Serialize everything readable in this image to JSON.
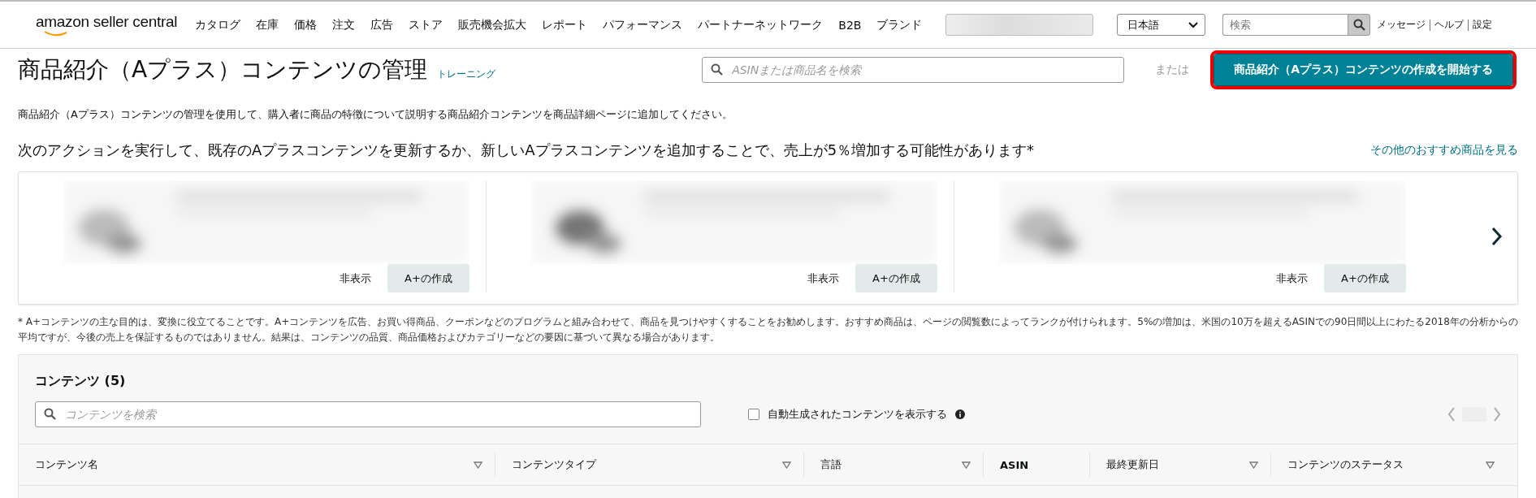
{
  "header": {
    "logo": "amazon seller central",
    "nav": [
      "カタログ",
      "在庫",
      "価格",
      "注文",
      "広告",
      "ストア",
      "販売機会拡大",
      "レポート",
      "パフォーマンス",
      "パートナーネットワーク",
      "B2B",
      "ブランド"
    ],
    "language": "日本語",
    "search": {
      "placeholder": "検索"
    },
    "links": [
      "メッセージ",
      "ヘルプ",
      "設定"
    ]
  },
  "page": {
    "title": "商品紹介（Aプラス）コンテンツの管理",
    "training_link": "トレーニング",
    "search": {
      "placeholder": "ASINまたは商品名を検索"
    },
    "or_label": "または",
    "start_button": "商品紹介（Aプラス）コンテンツの作成を開始する",
    "description": "商品紹介（Aプラス）コンテンツの管理を使用して、購入者に商品の特徴について説明する商品紹介コンテンツを商品詳細ページに追加してください。"
  },
  "recommendations": {
    "headline": "次のアクションを実行して、既存のAプラスコンテンツを更新するか、新しいAプラスコンテンツを追加することで、売上が5％増加する可能性があります*",
    "more_link": "その他のおすすめ商品を見る",
    "cards": [
      {
        "kind": "picture",
        "hide": "非表示",
        "create": "A+の作成"
      },
      {
        "kind": "picture",
        "hide": "非表示",
        "create": "A+の作成"
      },
      {
        "kind": "picture",
        "hide": "非表示",
        "create": "A+の作成"
      }
    ],
    "footnote": "* A+コンテンツの主な目的は、変換に役立てることです。A+コンテンツを広告、お買い得商品、クーポンなどのプログラムと組み合わせて、商品を見つけやすくすることをお勧めします。おすすめ商品は、ページの閲覧数によってランクが付けられます。5%の増加は、米国の10万を超えるASINでの90日間以上にわたる2018年の分析からの平均ですが、今後の売上を保証するものではありません。結果は、コンテンツの品質、商品価格およびカテゴリーなどの要因に基づいて異なる場合があります。"
  },
  "contents": {
    "title": "コンテンツ (5)",
    "search": {
      "placeholder": "コンテンツを検索"
    },
    "auto_generated": {
      "label": "自動生成されたコンテンツを表示する",
      "checked": false
    },
    "columns": [
      {
        "label": "コンテンツ名",
        "filter": true
      },
      {
        "label": "コンテンツタイプ",
        "filter": true
      },
      {
        "label": "言語",
        "filter": true
      },
      {
        "label": "ASIN",
        "filter": false
      },
      {
        "label": "最終更新日",
        "filter": true
      },
      {
        "label": "コンテンツのステータス",
        "filter": true
      }
    ]
  }
}
